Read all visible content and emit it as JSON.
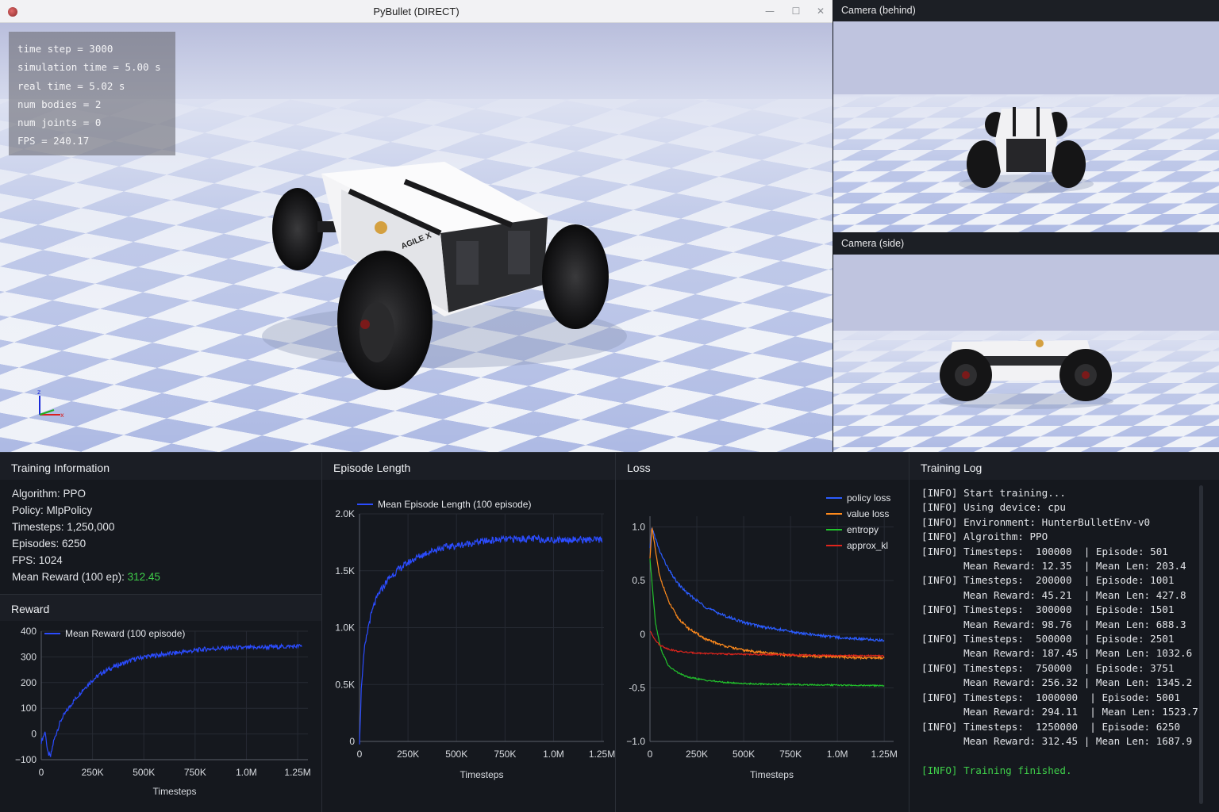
{
  "main_window": {
    "title": "PyBullet (DIRECT)",
    "controls": {
      "minimize": "—",
      "maximize": "☐",
      "close": "✕"
    },
    "hud": [
      "time step = 3000",
      "simulation time = 5.00 s",
      "real time = 5.02 s",
      "num bodies = 2",
      "num joints = 0",
      "FPS = 240.17"
    ],
    "axes_gizmo": {
      "z": "z",
      "x": "x"
    },
    "robot_brand": "AGILE X"
  },
  "cameras": [
    {
      "title": "Camera (behind)"
    },
    {
      "title": "Camera (side)"
    }
  ],
  "training_info": {
    "title": "Training Information",
    "lines": [
      {
        "label": "Algorithm: ",
        "value": "PPO"
      },
      {
        "label": "Policy: ",
        "value": "MlpPolicy"
      },
      {
        "label": "Timesteps: ",
        "value": "1,250,000"
      },
      {
        "label": "Episodes: ",
        "value": "6250"
      },
      {
        "label": "FPS: ",
        "value": "1024"
      }
    ],
    "mean_reward_label": "Mean Reward (100 ep): ",
    "mean_reward_value": "312.45",
    "colors": {
      "highlight": "#3fcf4a"
    }
  },
  "reward_panel": {
    "title": "Reward"
  },
  "episode_panel": {
    "title": "Episode Length"
  },
  "loss_panel": {
    "title": "Loss"
  },
  "chart_data": [
    {
      "type": "line",
      "title": "Reward",
      "xlabel": "Timesteps",
      "ylabel": "",
      "xlim": [
        0,
        1300000
      ],
      "ylim": [
        -100,
        400
      ],
      "x_ticks": [
        0,
        250000,
        500000,
        750000,
        1000000,
        1250000
      ],
      "x_tick_labels": [
        "0",
        "250K",
        "500K",
        "750K",
        "1.0M",
        "1.25M"
      ],
      "y_ticks": [
        -100,
        0,
        100,
        200,
        300,
        400
      ],
      "y_tick_labels": [
        "−100",
        "0",
        "100",
        "200",
        "300",
        "400"
      ],
      "grid": true,
      "legend": "top-left",
      "series": [
        {
          "name": "Mean Reward (100 episode)",
          "color": "#2b4cff",
          "x": [
            0,
            20000,
            30000,
            45000,
            60000,
            80000,
            100000,
            150000,
            200000,
            250000,
            300000,
            350000,
            400000,
            450000,
            500000,
            550000,
            600000,
            700000,
            800000,
            900000,
            1000000,
            1100000,
            1200000,
            1270000
          ],
          "y": [
            -30,
            10,
            -70,
            -90,
            -30,
            20,
            60,
            120,
            170,
            210,
            240,
            260,
            275,
            290,
            300,
            305,
            310,
            320,
            330,
            335,
            335,
            338,
            340,
            342
          ]
        }
      ]
    },
    {
      "type": "line",
      "title": "Episode Length",
      "xlabel": "Timesteps",
      "ylabel": "",
      "xlim": [
        0,
        1260000
      ],
      "ylim": [
        0,
        2000
      ],
      "x_ticks": [
        0,
        250000,
        500000,
        750000,
        1000000,
        1250000
      ],
      "x_tick_labels": [
        "0",
        "250K",
        "500K",
        "750K",
        "1.0M",
        "1.25M"
      ],
      "y_ticks": [
        0,
        500,
        1000,
        1500,
        2000
      ],
      "y_tick_labels": [
        "0",
        "0.5K",
        "1.0K",
        "1.5K",
        "2.0K"
      ],
      "grid": true,
      "legend": "top-left",
      "series": [
        {
          "name": "Mean Episode Length (100 episode)",
          "color": "#2b4cff",
          "x": [
            0,
            10000,
            25000,
            50000,
            75000,
            100000,
            150000,
            200000,
            250000,
            300000,
            350000,
            400000,
            450000,
            500000,
            600000,
            700000,
            800000,
            900000,
            1000000,
            1100000,
            1200000,
            1250000
          ],
          "y": [
            0,
            500,
            800,
            1050,
            1200,
            1300,
            1430,
            1510,
            1570,
            1620,
            1660,
            1690,
            1710,
            1720,
            1750,
            1770,
            1780,
            1780,
            1770,
            1775,
            1770,
            1770
          ]
        }
      ]
    },
    {
      "type": "line",
      "title": "Loss",
      "xlabel": "Timesteps",
      "ylabel": "",
      "xlim": [
        0,
        1300000
      ],
      "ylim": [
        -1.0,
        1.1
      ],
      "x_ticks": [
        0,
        250000,
        500000,
        750000,
        1000000,
        1250000
      ],
      "x_tick_labels": [
        "0",
        "250K",
        "500K",
        "750K",
        "1.0M",
        "1.25M"
      ],
      "y_ticks": [
        -1.0,
        -0.5,
        0,
        0.5,
        1.0
      ],
      "y_tick_labels": [
        "−1.0",
        "-0.5",
        "0",
        "0.5",
        "1.0"
      ],
      "grid": true,
      "legend": "top-right",
      "series": [
        {
          "name": "policy loss",
          "color": "#2b5cff",
          "x": [
            0,
            10000,
            50000,
            100000,
            150000,
            200000,
            300000,
            400000,
            500000,
            600000,
            700000,
            800000,
            900000,
            1000000,
            1100000,
            1250000
          ],
          "y": [
            0.8,
            1.0,
            0.78,
            0.6,
            0.47,
            0.38,
            0.25,
            0.17,
            0.11,
            0.07,
            0.04,
            0.01,
            -0.01,
            -0.03,
            -0.04,
            -0.06
          ]
        },
        {
          "name": "value loss",
          "color": "#ff8a1c",
          "x": [
            0,
            10000,
            50000,
            100000,
            150000,
            200000,
            300000,
            400000,
            500000,
            600000,
            700000,
            800000,
            900000,
            1000000,
            1100000,
            1250000
          ],
          "y": [
            0.7,
            1.0,
            0.55,
            0.3,
            0.15,
            0.06,
            -0.05,
            -0.11,
            -0.15,
            -0.17,
            -0.19,
            -0.2,
            -0.21,
            -0.21,
            -0.22,
            -0.22
          ]
        },
        {
          "name": "entropy",
          "color": "#22c32c",
          "x": [
            0,
            10000,
            30000,
            60000,
            100000,
            150000,
            200000,
            300000,
            400000,
            500000,
            600000,
            800000,
            1000000,
            1250000
          ],
          "y": [
            0.7,
            0.5,
            0.1,
            -0.15,
            -0.3,
            -0.36,
            -0.4,
            -0.43,
            -0.45,
            -0.46,
            -0.465,
            -0.47,
            -0.475,
            -0.48
          ]
        },
        {
          "name": "approx_kl",
          "color": "#e0241c",
          "x": [
            0,
            20000,
            50000,
            100000,
            150000,
            200000,
            300000,
            400000,
            600000,
            800000,
            1000000,
            1250000
          ],
          "y": [
            0.03,
            -0.03,
            -0.1,
            -0.14,
            -0.16,
            -0.17,
            -0.18,
            -0.185,
            -0.19,
            -0.195,
            -0.2,
            -0.2
          ]
        }
      ]
    }
  ],
  "training_log": {
    "title": "Training Log",
    "lines": [
      "[INFO] Start training...",
      "[INFO] Using device: cpu",
      "[INFO] Environment: HunterBulletEnv-v0",
      "[INFO] Algroithm: PPO",
      "[INFO] Timesteps:  100000  | Episode: 501",
      "       Mean Reward: 12.35  | Mean Len: 203.4",
      "[INFO] Timesteps:  200000  | Episode: 1001",
      "       Mean Reward: 45.21  | Mean Len: 427.8",
      "[INFO] Timesteps:  300000  | Episode: 1501",
      "       Mean Reward: 98.76  | Mean Len: 688.3",
      "[INFO] Timesteps:  500000  | Episode: 2501",
      "       Mean Reward: 187.45 | Mean Len: 1032.6",
      "[INFO] Timesteps:  750000  | Episode: 3751",
      "       Mean Reward: 256.32 | Mean Len: 1345.2",
      "[INFO] Timesteps:  1000000  | Episode: 5001",
      "       Mean Reward: 294.11  | Mean Len: 1523.7",
      "[INFO] Timesteps:  1250000  | Episode: 6250",
      "       Mean Reward: 312.45 | Mean Len: 1687.9",
      "",
      "[INFO] Training finished."
    ],
    "colors": {
      "success": "#3fcf4a"
    }
  }
}
